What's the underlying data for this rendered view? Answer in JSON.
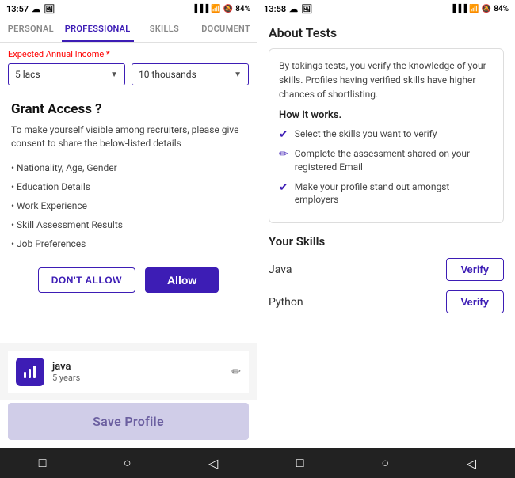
{
  "left_panel": {
    "status_bar": {
      "time": "13:57",
      "battery": "84%"
    },
    "tabs": [
      {
        "label": "PERSONAL",
        "active": false
      },
      {
        "label": "PROFESSIONAL",
        "active": true
      },
      {
        "label": "SKILLS",
        "active": false
      },
      {
        "label": "DOCUMENT",
        "active": false
      }
    ],
    "income": {
      "label": "Expected Annual Income",
      "required": "*",
      "lacs_value": "5 lacs",
      "thousands_value": "10 thousands"
    },
    "grant_access": {
      "title": "Grant Access ?",
      "description": "To make yourself visible among recruiters, please give consent to share the below-listed details",
      "items": [
        "Nationality, Age, Gender",
        "Education Details",
        "Work Experience",
        "Skill Assessment Results",
        "Job Preferences"
      ],
      "dont_allow_label": "DON'T ALLOW",
      "allow_label": "Allow"
    },
    "job_card": {
      "title": "java",
      "years": "5 years"
    },
    "save_profile_label": "Save Profile"
  },
  "right_panel": {
    "status_bar": {
      "time": "13:58",
      "battery": "84%"
    },
    "about_title": "About Tests",
    "about_intro": "By takings tests, you verify the knowledge of your skills. Profiles having verified skills have higher chances of shortlisting.",
    "how_it_works_title": "How it works.",
    "steps": [
      {
        "text": "Select the skills you want to verify",
        "icon": "✓"
      },
      {
        "text": "Complete the assessment shared on your registered Email",
        "icon": "✏"
      },
      {
        "text": "Make your profile stand out amongst employers",
        "icon": "✓"
      }
    ],
    "skills_title": "Your Skills",
    "skills": [
      {
        "name": "Java",
        "verify_label": "Verify"
      },
      {
        "name": "Python",
        "verify_label": "Verify"
      }
    ]
  },
  "nav": {
    "square_icon": "□",
    "circle_icon": "○",
    "back_icon": "◁"
  }
}
